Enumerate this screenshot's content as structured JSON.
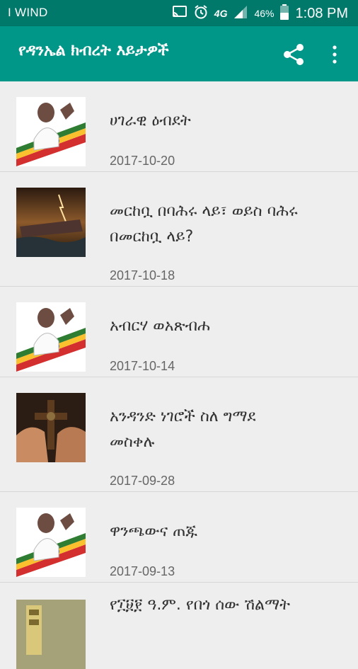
{
  "status_bar": {
    "carrier": "I WIND",
    "network_type": "4G",
    "battery_percent": "46%",
    "time": "1:08 PM",
    "icons": [
      "cast-icon",
      "alarm-icon",
      "signal-icon",
      "battery-icon"
    ]
  },
  "app_bar": {
    "title": "የዳንኤል ክብረት እይታዎች",
    "actions": [
      "share-icon",
      "more-vert-icon"
    ]
  },
  "articles": [
    {
      "title": "ሀገራዊ ዕብደት",
      "date": "2017-10-20",
      "thumbnail": "man-with-flag"
    },
    {
      "title": "መርከቧ በባሕሩ ላይ፣ ወይስ ባሕሩ\nበመርከቧ ላይ?",
      "date": "2017-10-18",
      "thumbnail": "ark-in-storm"
    },
    {
      "title": "አብርሃ ወአጽብሐ",
      "date": "2017-10-14",
      "thumbnail": "man-with-flag"
    },
    {
      "title": "አንዳንድ ነገሮች ስለ ግማደ\nመስቀሉ",
      "date": "2017-09-28",
      "thumbnail": "hands-with-cross"
    },
    {
      "title": "ዋንጫውና ጠጁ",
      "date": "2017-09-13",
      "thumbnail": "man-with-flag"
    },
    {
      "title": "የ፲፱፻ ዓ.ም. የበጎ ሰው ሽልማት",
      "date": "",
      "thumbnail": "award-poster"
    }
  ],
  "colors": {
    "status_bar": "#00796b",
    "app_bar": "#009688",
    "background": "#eeeeee"
  }
}
